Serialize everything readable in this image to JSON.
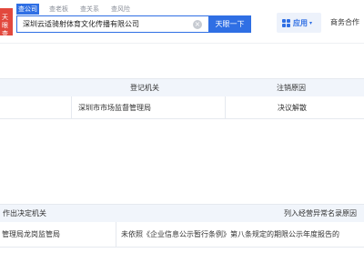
{
  "header": {
    "logo_text": "天眼查询",
    "tabs": [
      "查公司",
      "查老板",
      "查关系",
      "查风险"
    ],
    "search_value": "深圳云适骑射体育文化传播有限公司",
    "clear_glyph": "×",
    "search_button": "天眼一下",
    "apps_label": "应用",
    "apps_caret": "▾",
    "biz_link": "商务合作"
  },
  "registration_table": {
    "headers": [
      "登记机关",
      "注销原因"
    ],
    "rows": [
      [
        "深圳市市场监督管理局",
        "决议解散"
      ]
    ]
  },
  "abnormal_table": {
    "headers": [
      "作出决定机关",
      "列入经营异常名录原因"
    ],
    "rows": [
      [
        "管理局龙岗监管局",
        "未依照《企业信息公示暂行条例》第八条规定的期限公示年度报告的"
      ]
    ]
  },
  "colors": {
    "accent": "#2f6fe4",
    "logo_red": "#e2483d",
    "table_header_bg": "#f1f5fb"
  }
}
